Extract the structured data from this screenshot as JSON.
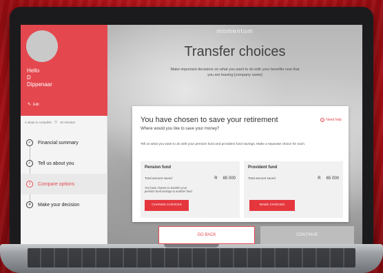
{
  "brand": "momentum",
  "header": {
    "title": "Transfer choices",
    "subtitle": "Make important decisions on what you want to do with your benefits now that you are leaving [company name]"
  },
  "sidebar": {
    "greeting": "Hello",
    "first_initial": "D",
    "last_name": "Dippenaar",
    "edit_label": "Edit",
    "steps_remaining": "4 steps to complete",
    "time_estimate": "15 minutes",
    "steps": [
      {
        "number": "✓",
        "label": "Financial summary"
      },
      {
        "number": "✓",
        "label": "Tell us about you"
      },
      {
        "number": "3",
        "label": "Compare options"
      },
      {
        "number": "4",
        "label": "Make your decision"
      }
    ]
  },
  "card": {
    "title": "You have chosen to save your retirement",
    "subtitle": "Where would you like to save your money?",
    "help_label": "Need help",
    "description": "Tell us what you want to do with your pension fund and provident fund savings.  Make a separate choice for each.",
    "pension": {
      "title": "Pension fund",
      "amount_label": "Total amount saved",
      "currency": "R",
      "amount": "85 000",
      "note": "You have chosen to transfer your pension fund savings to another fund",
      "button": "CHANGE CHOICES"
    },
    "provident": {
      "title": "Provident fund",
      "amount_label": "Total amount saved",
      "currency": "R",
      "amount": "65 000",
      "button": "MAKE CHOICES"
    }
  },
  "actions": {
    "back": "GO BACK",
    "continue": "CONTINUE"
  },
  "colors": {
    "accent": "#e5474e",
    "button_red": "#e5363d",
    "background_red": "#c4161c"
  }
}
